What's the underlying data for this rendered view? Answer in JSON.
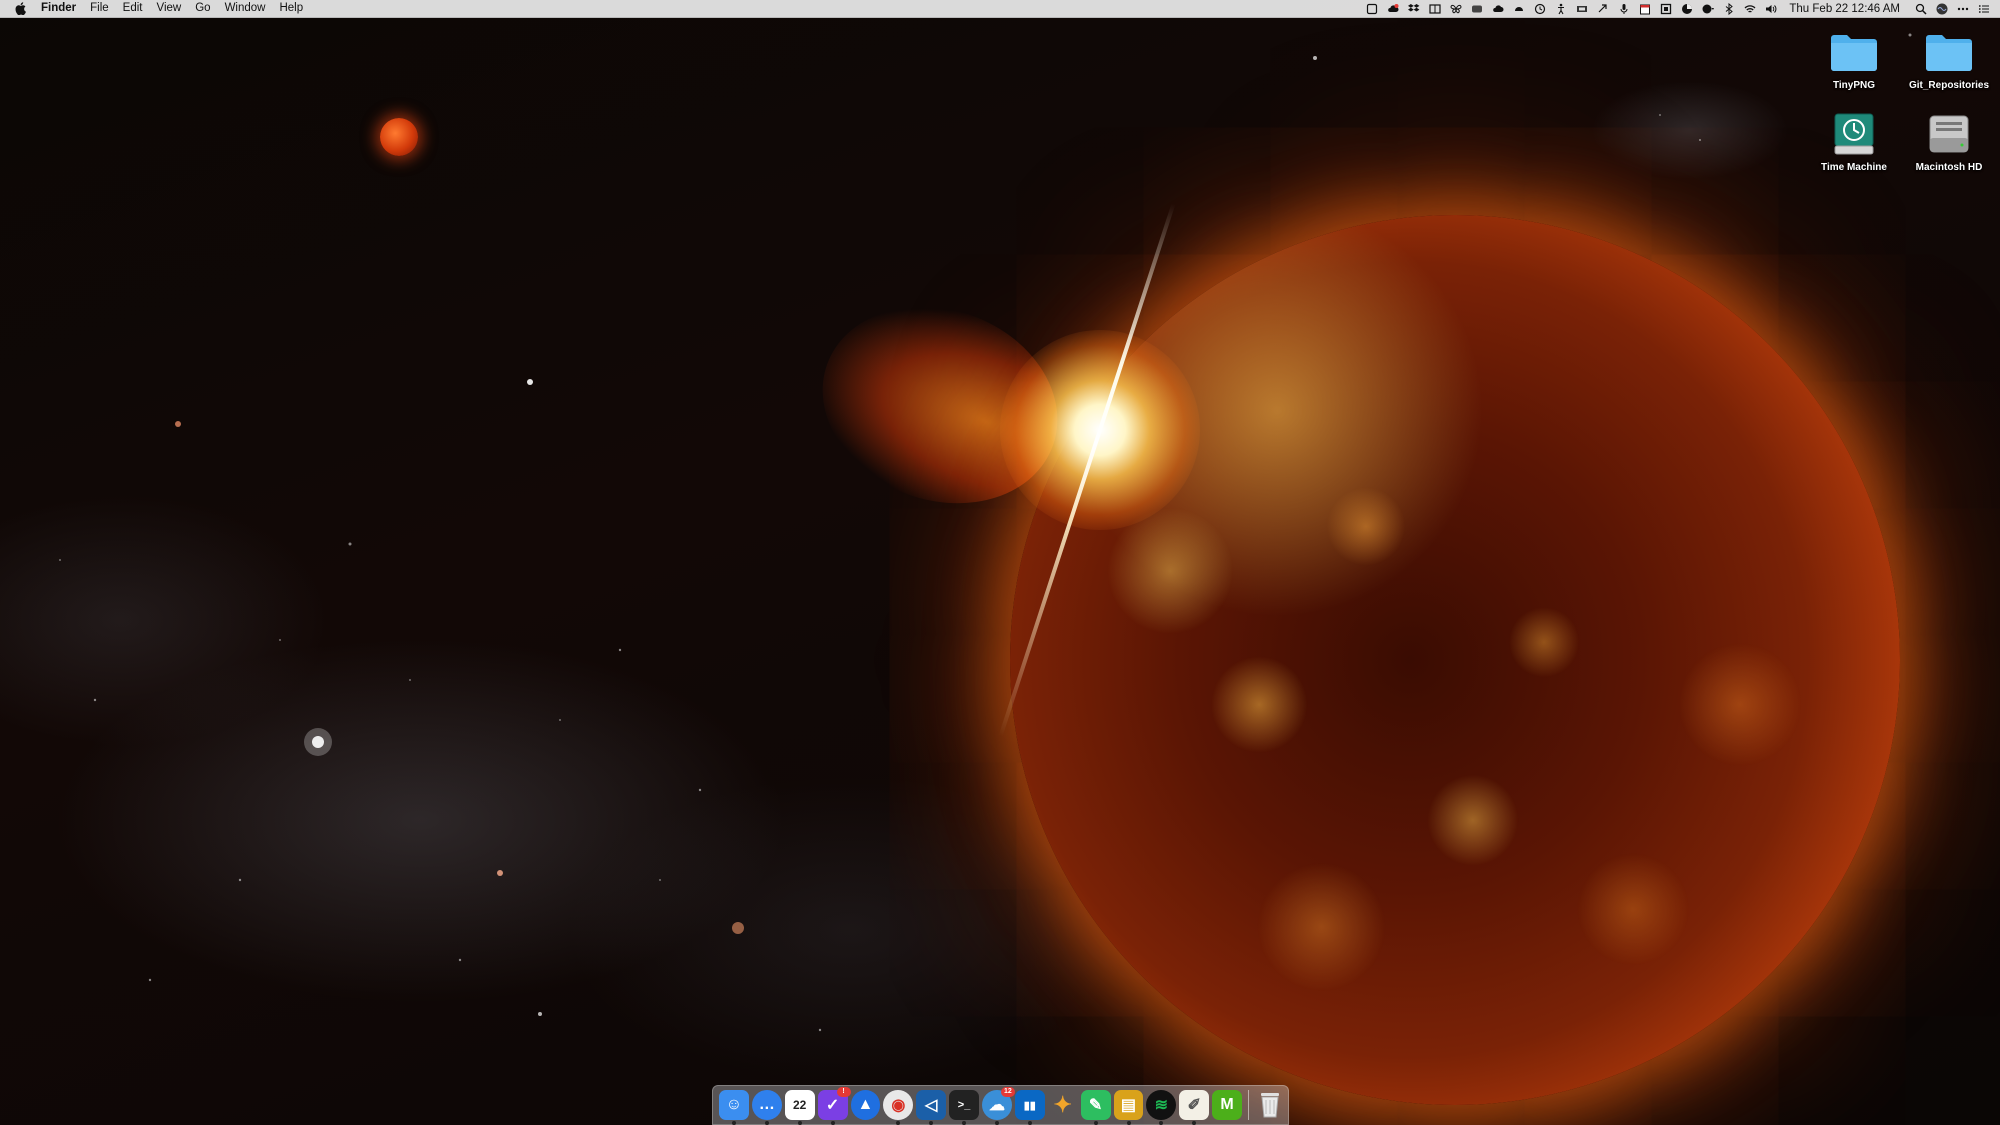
{
  "menubar": {
    "app_name": "Finder",
    "menus": [
      "File",
      "Edit",
      "View",
      "Go",
      "Window",
      "Help"
    ],
    "clock": "Thu Feb 22  12:46 AM"
  },
  "desktop": {
    "icons": [
      {
        "label": "TinyPNG",
        "icon": "folder-icon"
      },
      {
        "label": "Git_Repositories",
        "icon": "folder-icon"
      },
      {
        "label": "Time Machine",
        "icon": "time-machine-icon"
      },
      {
        "label": "Macintosh HD",
        "icon": "hard-drive-icon"
      }
    ]
  },
  "dock": {
    "apps": [
      {
        "name": "finder-icon",
        "color": "#3b8ef0",
        "glyph": "☺"
      },
      {
        "name": "messages-icon",
        "color": "#2f80ed",
        "glyph": "…"
      },
      {
        "name": "calendar-icon",
        "color": "#ffffff",
        "glyph": "22"
      },
      {
        "name": "omnifocus-icon",
        "color": "#7b3fe4",
        "glyph": "✓"
      },
      {
        "name": "safari-icon",
        "color": "#1f6fe0",
        "glyph": "▲"
      },
      {
        "name": "chrome-icon",
        "color": "#e8e8e8",
        "glyph": "◉"
      },
      {
        "name": "vscode-icon",
        "color": "#1b5fa8",
        "glyph": "◁"
      },
      {
        "name": "terminal-icon",
        "color": "#222222",
        "glyph": ">_"
      },
      {
        "name": "tweetbot-icon",
        "color": "#3a8fd8",
        "glyph": "☁"
      },
      {
        "name": "trello-icon",
        "color": "#0a68c4",
        "glyph": "▮▮"
      },
      {
        "name": "tes-icon",
        "color": "#f1a52a",
        "glyph": "✦"
      },
      {
        "name": "evernote-icon",
        "color": "#2dbe60",
        "glyph": "✎"
      },
      {
        "name": "notes-icon",
        "color": "#d9a21b",
        "glyph": "▤"
      },
      {
        "name": "spotify-icon",
        "color": "#1db954",
        "glyph": "≋"
      },
      {
        "name": "textedit-icon",
        "color": "#f3f0e6",
        "glyph": "✐"
      },
      {
        "name": "markdown-icon",
        "color": "#4caf1a",
        "glyph": "M"
      }
    ],
    "trash": {
      "name": "trash-icon"
    }
  }
}
